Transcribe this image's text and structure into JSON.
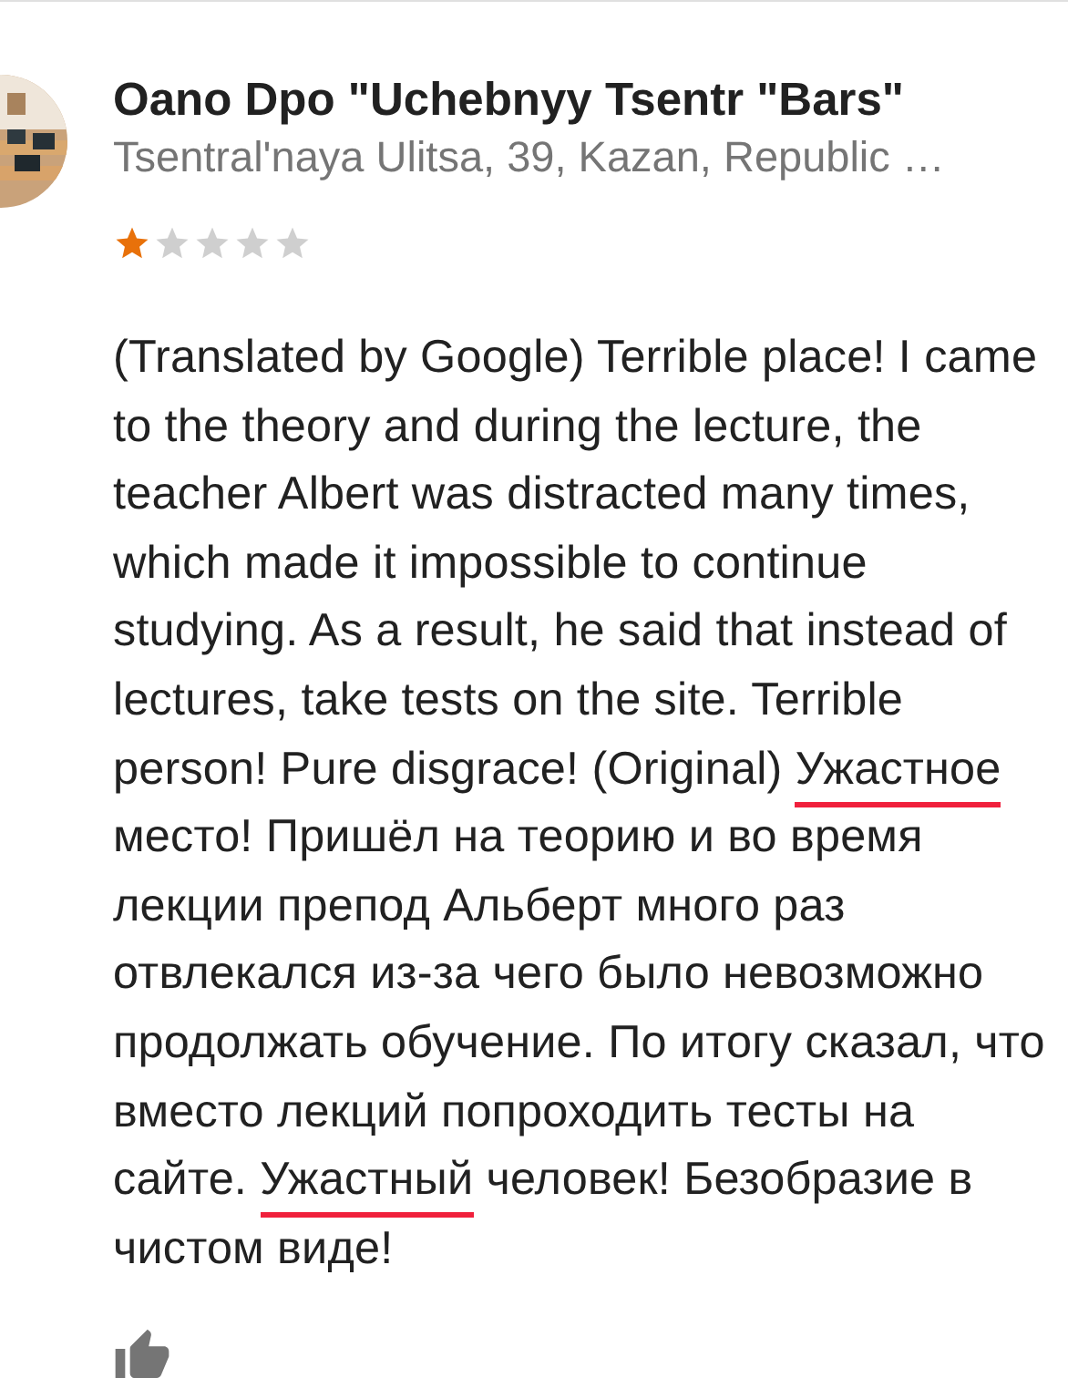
{
  "place": {
    "kind": "picture",
    "name": "Oano Dpo \"Uchebnyy Tsentr \"Bars\"",
    "address": "Tsentral'naya Ulitsa, 39, Kazan, Republic …"
  },
  "review": {
    "stars": 1,
    "segments": [
      {
        "text": "(Translated by Google) Terrible place! I came to the theory and during the lecture, the teacher Albert was distracted many times, which made it impossible to continue studying. As a result, he said that instead of lectures, take tests on the site. Terrible person! Pure disgrace! (Original) ",
        "underlined": false
      },
      {
        "text": "Ужастное",
        "underlined": true
      },
      {
        "text": " место! Пришёл на теорию и во время лекции препод Альберт много раз отвлекался из-за чего было невозможно продолжать обучение. По итогу сказал, что вместо лекций попроходить тесты на сайте. ",
        "underlined": false
      },
      {
        "text": "Ужастный",
        "underlined": true
      },
      {
        "text": " человек! Безобразие в чистом виде!",
        "underlined": false
      }
    ]
  }
}
